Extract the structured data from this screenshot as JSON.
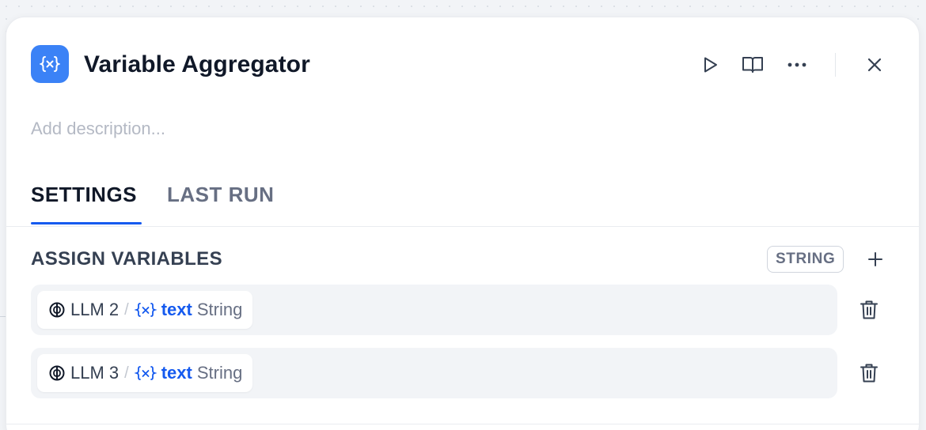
{
  "node": {
    "icon": "variable-icon",
    "icon_color": "#3b82f6",
    "title": "Variable Aggregator",
    "description_placeholder": "Add description..."
  },
  "header_actions": [
    {
      "name": "run-step-button",
      "icon": "play-icon"
    },
    {
      "name": "help-docs-button",
      "icon": "book-icon"
    },
    {
      "name": "more-options-button",
      "icon": "more-horizontal-icon"
    },
    {
      "name": "close-panel-button",
      "icon": "close-icon"
    }
  ],
  "tabs": {
    "settings": "SETTINGS",
    "last_run": "LAST RUN",
    "active": "settings",
    "accent": "#155aef"
  },
  "assign": {
    "title": "ASSIGN VARIABLES",
    "type_badge": "STRING",
    "variables": [
      {
        "node_icon": "llm-icon",
        "node": "LLM 2",
        "separator": "/",
        "var_icon": "variable-icon",
        "var": "text",
        "type": "String"
      },
      {
        "node_icon": "llm-icon",
        "node": "LLM 3",
        "separator": "/",
        "var_icon": "variable-icon",
        "var": "text",
        "type": "String"
      }
    ]
  }
}
